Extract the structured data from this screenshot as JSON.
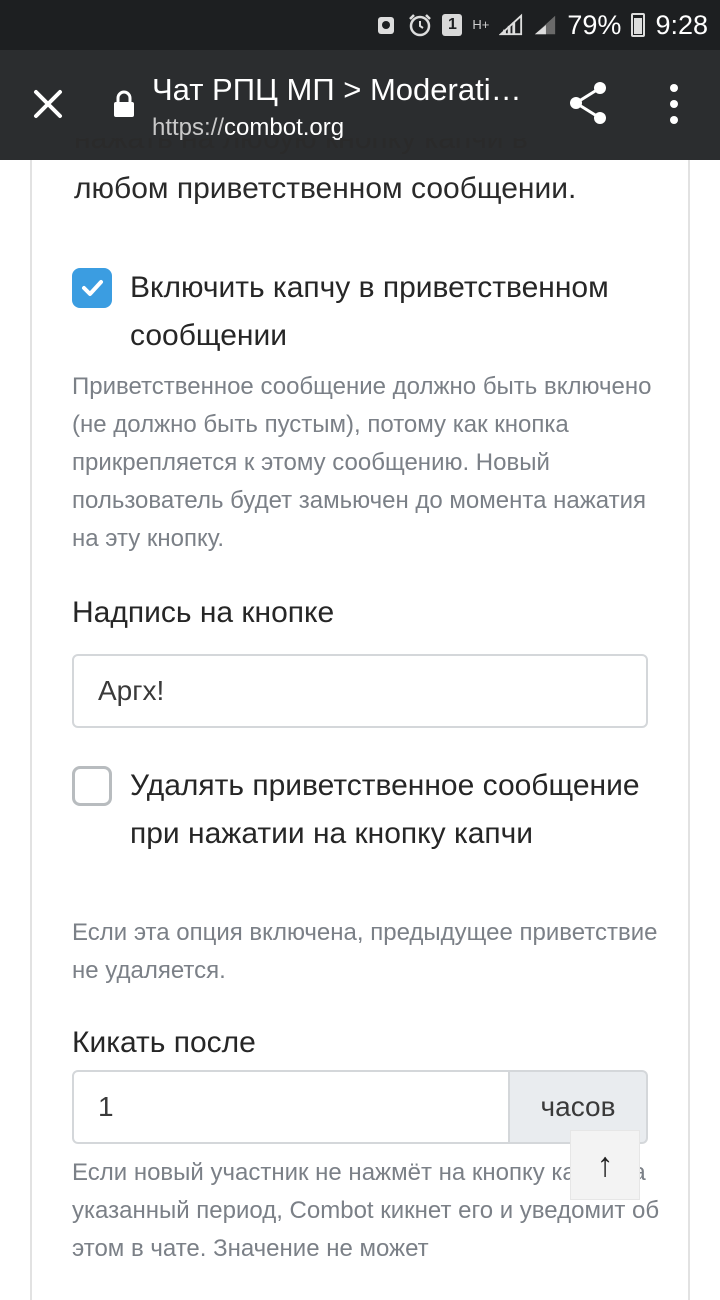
{
  "status_bar": {
    "sim_badge": "1",
    "network_type": "H+",
    "battery_percent": "79%",
    "time": "9:28"
  },
  "toolbar": {
    "title": "Чат РПЦ МП > Moderati…",
    "url_scheme": "https://",
    "url_host": "combot.org"
  },
  "content": {
    "intro_clipped_line": "нажать на любую кнопку капчи в",
    "intro_line": "любом приветственном сообщении.",
    "captcha_checkbox": {
      "label": "Включить капчу в приветственном сообщении",
      "checked": true,
      "help": "Приветственное сообщение должно быть включено (не должно быть пустым), потому как кнопка прикрепляется к этому сообщению. Новый пользователь будет замьючен до момента нажатия на эту кнопку."
    },
    "button_caption": {
      "label": "Надпись на кнопке",
      "value": "Аргх!"
    },
    "delete_checkbox": {
      "label": "Удалять приветственное сообщение при нажатии на кнопку капчи",
      "checked": false,
      "help": "Если эта опция включена, предыдущее приветствие не удаляется."
    },
    "kick_after": {
      "label": "Кикать после",
      "value": "1",
      "unit": "часов",
      "help": "Если новый участник не нажмёт на кнопку капчи за указанный период, Combot кикнет его и уведомит об этом в чате. Значение не может"
    }
  },
  "scroll_top_glyph": "↑",
  "colors": {
    "status_bar_bg": "#1d1f21",
    "toolbar_bg": "#2b2d2f",
    "checkbox_accent": "#3b9de1",
    "help_text": "#7b8087"
  }
}
